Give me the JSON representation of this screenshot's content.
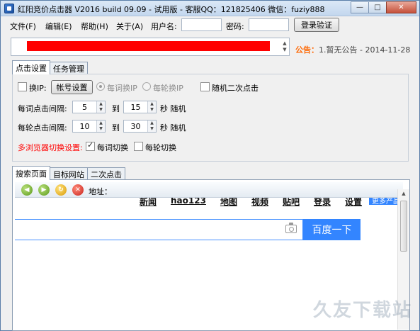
{
  "window": {
    "title": "红阳竞价点击器 V2016 build 09.09 - 试用版 - 客服QQ：121825406 微信：fuziy888",
    "minimize": "—",
    "maximize": "□",
    "close": "✕"
  },
  "menu": {
    "file": "文件(F)",
    "edit": "编辑(E)",
    "help": "帮助(H)",
    "about": "关于(A)"
  },
  "login": {
    "username_label": "用户名:",
    "username_value": "",
    "password_label": "密码:",
    "password_value": "",
    "login_button": "登录验证"
  },
  "notice": {
    "header": "公告：",
    "text": "1.暂无公告 - 2014-11-28"
  },
  "settings_tabs": [
    "点击设置",
    "任务管理"
  ],
  "settings": {
    "change_ip_label": "换IP:",
    "account_settings_button": "帐号设置",
    "radio_per_click": "每词换IP",
    "radio_per_round": "每轮换IP",
    "random_second_click": "随机二次点击",
    "per_word_interval_label": "每词点击间隔:",
    "per_word_min": "5",
    "per_word_max": "15",
    "per_round_interval_label": "每轮点击间隔:",
    "per_round_min": "10",
    "per_round_max": "30",
    "to": "到",
    "seconds_random": "秒 随机",
    "multi_browser_label": "多浏览器切换设置:",
    "switch_per_word": "每词切换",
    "switch_per_round": "每轮切换"
  },
  "browser_tabs": [
    "搜索页面",
    "目标网站",
    "二次点击"
  ],
  "browser": {
    "address_label": "地址："
  },
  "baidu": {
    "links": [
      "新闻",
      "hao123",
      "地图",
      "视频",
      "贴吧",
      "登录",
      "设置"
    ],
    "more_products": "更多产品",
    "search_button": "百度一下"
  },
  "watermark": "久友下载站"
}
